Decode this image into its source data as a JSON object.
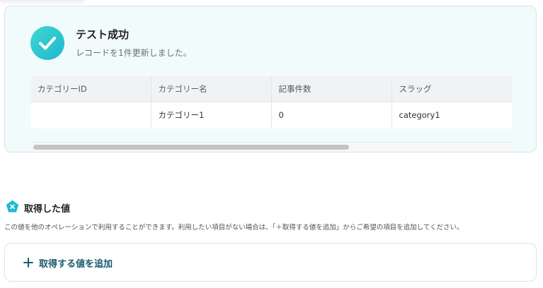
{
  "result": {
    "title": "テスト成功",
    "subtitle": "レコードを1件更新しました。",
    "status_icon": "check-circle-icon",
    "table": {
      "columns": [
        "カテゴリーID",
        "カテゴリー名",
        "記事件数",
        "スラッグ"
      ],
      "rows": [
        [
          "",
          "カテゴリー1",
          "0",
          "category1"
        ]
      ]
    }
  },
  "acquired": {
    "title": "取得した値",
    "icon": "pentagon-x-icon",
    "description": "この値を他のオペレーションで利用することができます。利用したい項目がない場合は、「＋取得する値を追加」からご希望の項目を追加してください。",
    "add_label": "取得する値を追加"
  },
  "colors": {
    "accent": "#1fb6cf",
    "panel_bg": "#f2fbfb",
    "add_text": "#1a5a70"
  }
}
